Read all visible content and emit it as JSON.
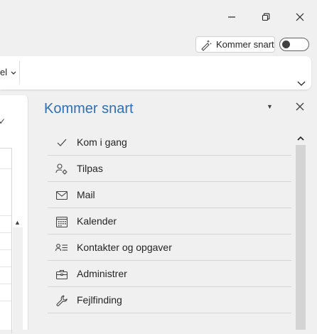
{
  "window": {
    "minimize_icon": "minimize-icon",
    "restore_icon": "restore-icon",
    "close_icon": "close-icon"
  },
  "coming_soon": {
    "button_label": "Kommer snart",
    "toggle_state": "off"
  },
  "ribbon": {
    "cut_text": "el"
  },
  "pane": {
    "title": "Kommer snart",
    "items": [
      {
        "label": "Kom i gang",
        "icon": "check-icon"
      },
      {
        "label": "Tilpas",
        "icon": "person-gear-icon"
      },
      {
        "label": "Mail",
        "icon": "mail-icon"
      },
      {
        "label": "Kalender",
        "icon": "calendar-icon"
      },
      {
        "label": "Kontakter og opgaver",
        "icon": "contacts-list-icon"
      },
      {
        "label": "Administrer",
        "icon": "briefcase-icon"
      },
      {
        "label": "Fejlfinding",
        "icon": "wrench-icon"
      }
    ]
  },
  "colors": {
    "title_blue": "#2f6fb5",
    "background": "#f0f0f0"
  }
}
